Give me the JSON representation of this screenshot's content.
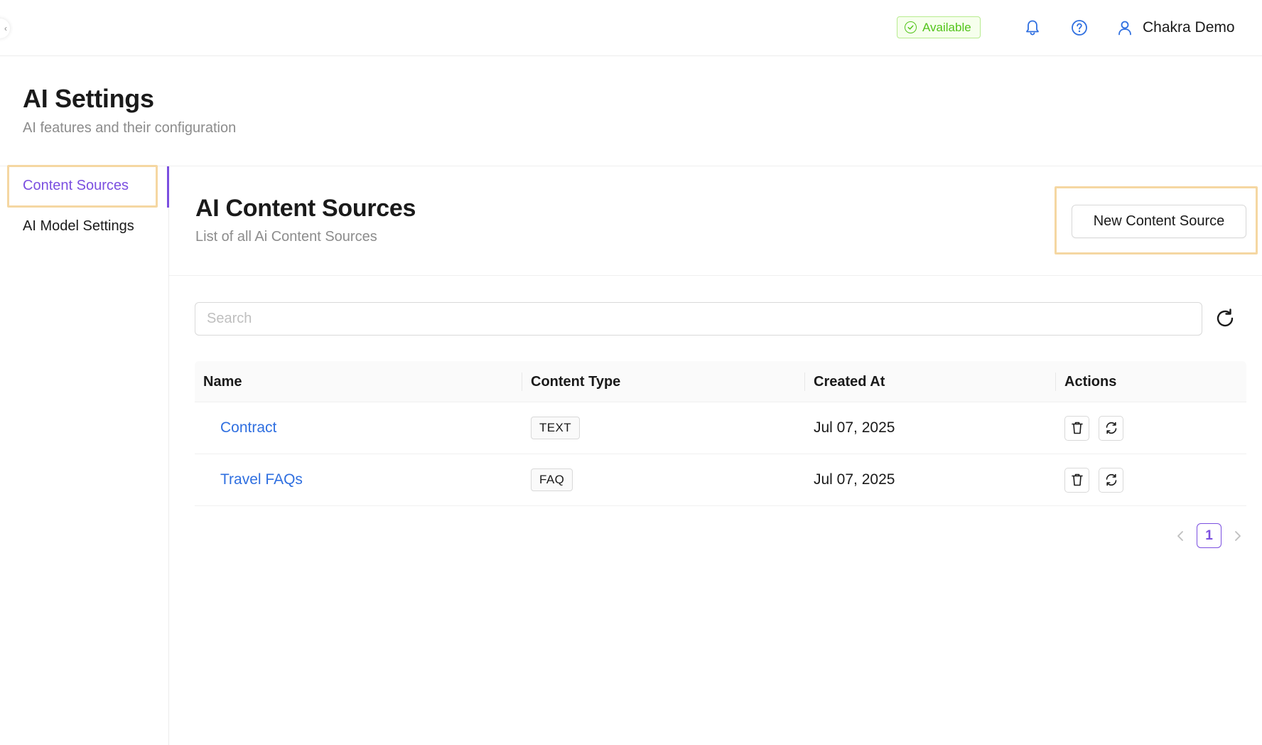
{
  "header": {
    "status": "Available",
    "user_name": "Chakra Demo",
    "icons": [
      "bell-icon",
      "help-icon",
      "user-icon"
    ]
  },
  "page": {
    "title": "AI Settings",
    "subtitle": "AI features and their configuration"
  },
  "sidebar": {
    "items": [
      {
        "label": "Content Sources",
        "active": true
      },
      {
        "label": "AI Model Settings",
        "active": false
      }
    ]
  },
  "content": {
    "title": "AI Content Sources",
    "subtitle": "List of all Ai Content Sources",
    "new_button": "New Content Source"
  },
  "search": {
    "placeholder": "Search",
    "value": ""
  },
  "table": {
    "columns": [
      "Name",
      "Content Type",
      "Created At",
      "Actions"
    ],
    "rows": [
      {
        "name": "Contract",
        "type": "TEXT",
        "created": "Jul 07, 2025"
      },
      {
        "name": "Travel FAQs",
        "type": "FAQ",
        "created": "Jul 07, 2025"
      }
    ]
  },
  "pagination": {
    "current_page": "1"
  },
  "colors": {
    "accent": "#7b4fe0",
    "link": "#2f6fe0",
    "status_green": "#52c41a",
    "highlight": "#f5d7a2"
  }
}
